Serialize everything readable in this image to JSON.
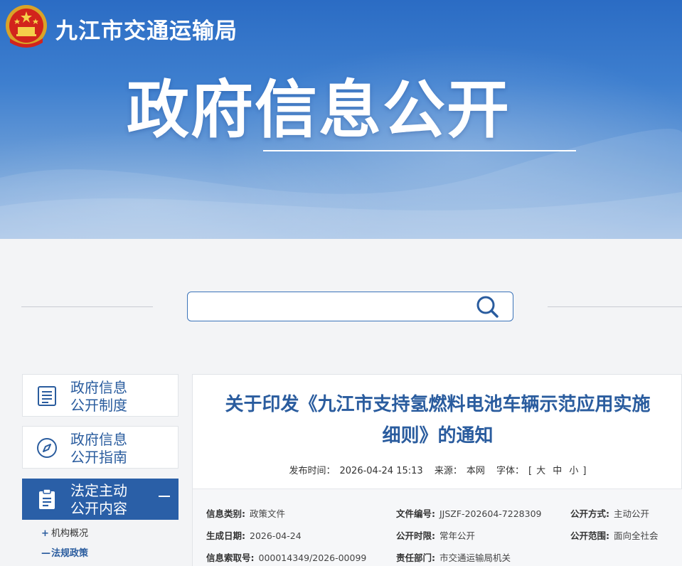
{
  "header": {
    "site_name": "九江市交通运输局",
    "banner_title": "政府信息公开"
  },
  "search": {
    "placeholder": ""
  },
  "sidebar": {
    "items": [
      {
        "line1": "政府信息",
        "line2": "公开制度",
        "icon": "list-document-icon"
      },
      {
        "line1": "政府信息",
        "line2": "公开指南",
        "icon": "compass-icon"
      },
      {
        "line1": "法定主动",
        "line2": "公开内容",
        "icon": "clipboard-icon",
        "active": true
      }
    ],
    "sub_items": [
      {
        "mark": "+",
        "label": "机构概况"
      },
      {
        "mark": "—",
        "label": "法规政策"
      }
    ]
  },
  "article": {
    "title_line1": "关于印发《九江市支持氢燃料电池车辆示范应用实施",
    "title_line2": "细则》的通知",
    "meta": {
      "publish_label": "发布时间：",
      "publish_value": "2026-04-24 15:13",
      "source_label": "来源：",
      "source_value": "本网",
      "font_label": "字体：",
      "bracket_open": "[",
      "font_large": "大",
      "font_medium": "中",
      "font_small": "小",
      "bracket_close": "]"
    },
    "info": {
      "category_label": "信息类别:",
      "category_value": "政策文件",
      "doc_no_label": "文件编号:",
      "doc_no_value": "JJSZF-202604-7228309",
      "open_mode_label": "公开方式:",
      "open_mode_value": "主动公开",
      "date_label": "生成日期:",
      "date_value": "2026-04-24",
      "period_label": "公开时限:",
      "period_value": "常年公开",
      "scope_label": "公开范围:",
      "scope_value": "面向全社会",
      "index_label": "信息索取号:",
      "index_value": "000014349/2026-00099",
      "dept_label": "责任部门:",
      "dept_value": "市交通运输局机关"
    }
  },
  "colors": {
    "accent": "#2a5c9e",
    "active_bg": "#2a5fa7",
    "banner": "#3e7fcf"
  }
}
